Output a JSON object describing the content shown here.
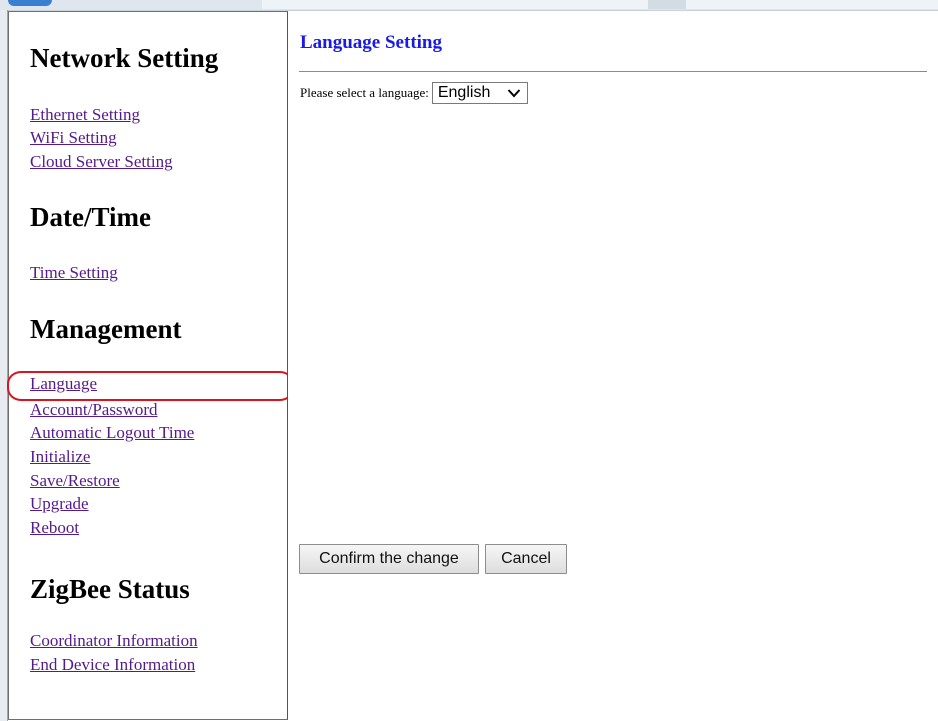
{
  "sidebar": {
    "sections": [
      {
        "title": "Network Setting",
        "links": [
          "Ethernet Setting",
          "WiFi Setting",
          "Cloud Server Setting"
        ]
      },
      {
        "title": "Date/Time",
        "links": [
          "Time Setting"
        ]
      },
      {
        "title": "Management",
        "links": [
          "Language",
          "Account/Password",
          "Automatic Logout Time",
          "Initialize",
          "Save/Restore",
          "Upgrade",
          "Reboot"
        ]
      },
      {
        "title": "ZigBee Status",
        "links": [
          "Coordinator Information",
          "End Device Information"
        ]
      }
    ],
    "highlighted_link": "Language",
    "link_color": "#551a8b",
    "highlight_color": "#d9141f"
  },
  "main": {
    "title": "Language Setting",
    "title_color": "#1a1ae6",
    "language_label": "Please select a language:",
    "language_selected": "English",
    "confirm_label": "Confirm the change",
    "cancel_label": "Cancel"
  }
}
